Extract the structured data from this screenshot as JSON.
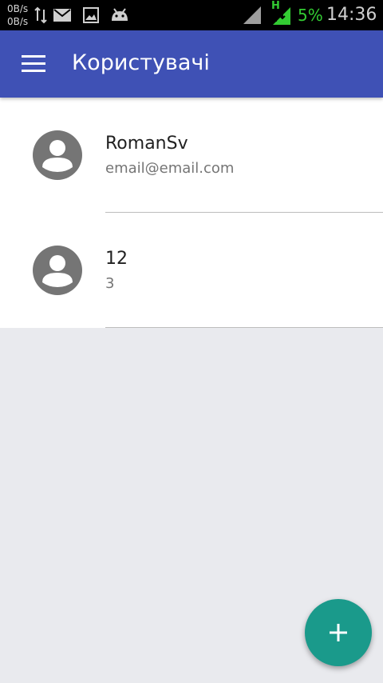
{
  "status_bar": {
    "net_up": "0B/s",
    "net_down": "0B/s",
    "battery": "5%",
    "time": "14:36",
    "network_type": "H",
    "icons": [
      "data-transfer-icon",
      "mail-icon",
      "image-icon",
      "android-icon",
      "signal-icon",
      "data-signal-icon"
    ],
    "battery_color": "#33cc33"
  },
  "app_bar": {
    "title": "Користувачі",
    "color": "#3f51b5",
    "menu_icon": "hamburger-menu-icon"
  },
  "users": [
    {
      "name": "RomanSv",
      "subtitle": "email@email.com",
      "icon": "account-circle-icon"
    },
    {
      "name": "12",
      "subtitle": "3",
      "icon": "account-circle-icon"
    }
  ],
  "fab": {
    "icon": "plus-icon",
    "color": "#1a9a8b"
  }
}
